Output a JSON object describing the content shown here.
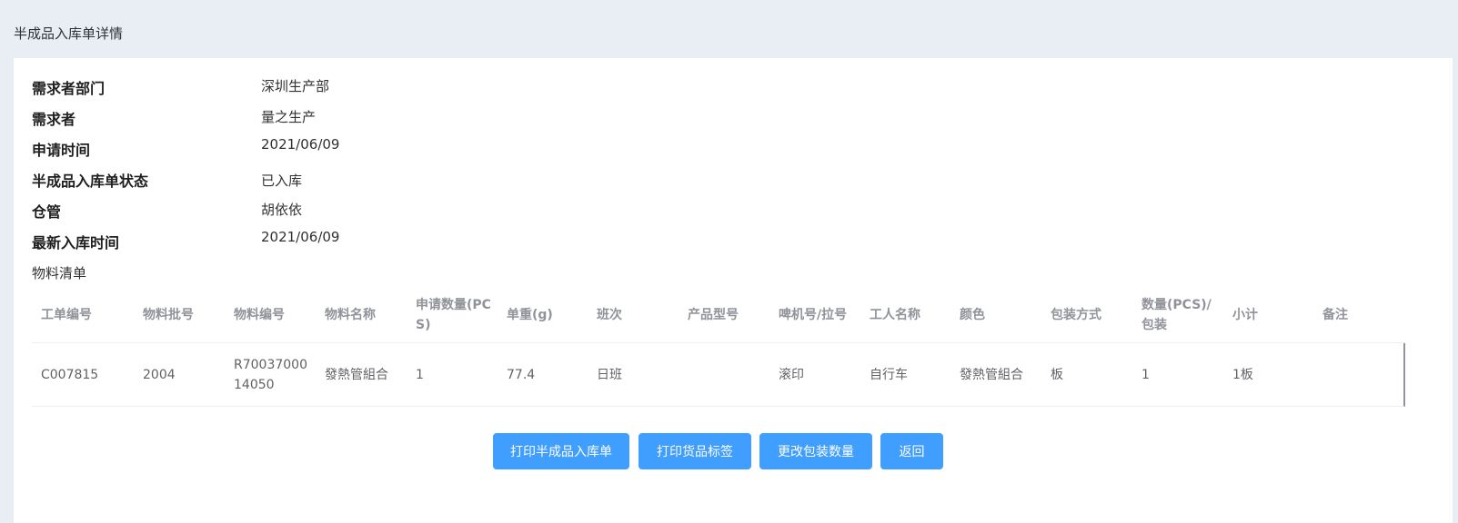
{
  "page": {
    "title": "半成品入库单详情"
  },
  "info": [
    {
      "label": "需求者部门",
      "value": "深圳生产部"
    },
    {
      "label": "需求者",
      "value": "量之生产"
    },
    {
      "label": "申请时间",
      "value": "2021/06/09"
    },
    {
      "label": "半成品入库单状态",
      "value": "已入库"
    },
    {
      "label": "仓管",
      "value": "胡依依"
    },
    {
      "label": "最新入库时间",
      "value": "2021/06/09"
    }
  ],
  "materials": {
    "title": "物料清单",
    "columns": [
      "工单编号",
      "物料批号",
      "物料编号",
      "物料名称",
      "申请数量(PCS)",
      "单重(g)",
      "班次",
      "产品型号",
      "啤机号/拉号",
      "工人名称",
      "颜色",
      "包装方式",
      "数量(PCS)/包装",
      "小计",
      "备注"
    ],
    "rows": [
      [
        "C007815",
        "2004",
        "R7003700014050",
        "發熱管組合",
        "1",
        "77.4",
        "日班",
        "",
        "滚印",
        "自行车",
        "發熱管組合",
        "板",
        "1",
        "1板",
        ""
      ]
    ]
  },
  "actions": {
    "print_inbound": "打印半成品入库单",
    "print_label": "打印货品标签",
    "change_pack_qty": "更改包装数量",
    "back": "返回"
  },
  "colors": {
    "primary": "#409eff",
    "background": "#e9edf4"
  }
}
